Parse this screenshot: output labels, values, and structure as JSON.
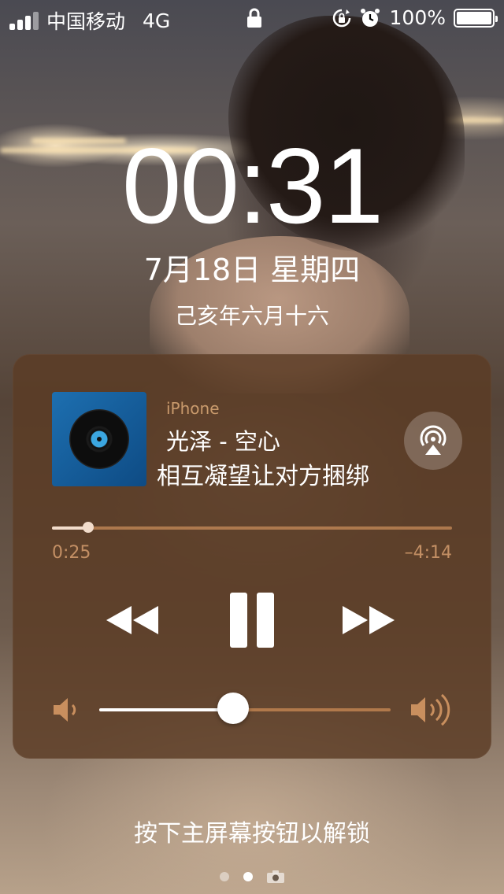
{
  "status_bar": {
    "carrier": "中国移动",
    "network": "4G",
    "battery_percent": "100%",
    "signal_bars": 3,
    "signal_total": 4,
    "icons": [
      "lock-icon",
      "rotation-lock-icon",
      "alarm-icon",
      "battery-icon"
    ]
  },
  "lock_screen": {
    "time": "00:31",
    "date": "7月18日 星期四",
    "lunar_date": "己亥年六月十六",
    "unlock_hint": "按下主屏幕按钮以解锁"
  },
  "now_playing": {
    "source": "iPhone",
    "title": "光泽 - 空心",
    "lyric": "相互凝望让对方捆绑",
    "elapsed": "0:25",
    "remaining": "–4:14",
    "progress_fraction": 0.09,
    "volume_fraction": 0.46,
    "icons": {
      "airplay": "airplay-icon",
      "rewind": "rewind-icon",
      "pause": "pause-icon",
      "forward": "fast-forward-icon",
      "volume_low": "volume-low-icon",
      "volume_high": "volume-high-icon",
      "album": "vinyl-record-icon"
    },
    "colors": {
      "panel": "#5c3c24",
      "accent": "#dca878",
      "album_bg": "#1d6fb0",
      "disc_label": "#3ba6e0"
    }
  },
  "pager": {
    "pages": 2,
    "active_index": 1,
    "trailing_icon": "camera-icon"
  }
}
